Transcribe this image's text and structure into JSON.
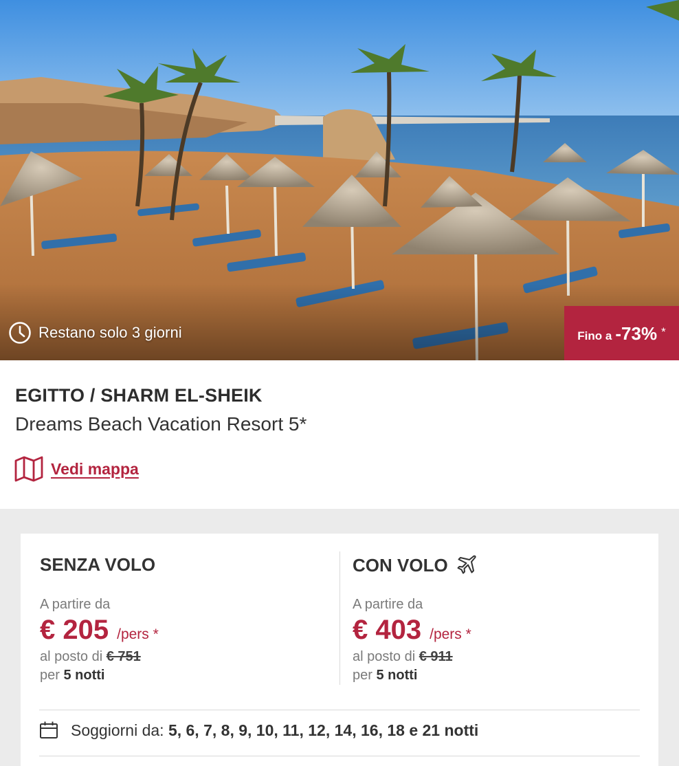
{
  "hero": {
    "countdown_text": "Restano solo 3 giorni",
    "discount_prefix": "Fino a",
    "discount_value": "-73%",
    "discount_asterisk": "*"
  },
  "listing": {
    "destination": "EGITTO / SHARM EL-SHEIK",
    "hotel_name": "Dreams Beach Vacation Resort 5*",
    "map_link_label": "Vedi mappa"
  },
  "offers": {
    "without_flight": {
      "title": "SENZA VOLO",
      "from_label": "A partire da",
      "price": "€ 205",
      "per_label": "/pers *",
      "instead_label": "al posto di",
      "old_price": "€ 751",
      "nights_prefix": "per",
      "nights": "5 notti"
    },
    "with_flight": {
      "title": "CON VOLO",
      "from_label": "A partire da",
      "price": "€ 403",
      "per_label": "/pers *",
      "instead_label": "al posto di",
      "old_price": "€ 911",
      "nights_prefix": "per",
      "nights": "5 notti"
    },
    "stays_label": "Soggiorni da:",
    "stays_values": "5, 6, 7, 8, 9, 10, 11, 12, 14, 16, 18 e 21 notti"
  },
  "icons": {
    "countdown": "clock-icon",
    "map": "map-icon",
    "flight": "airplane-icon",
    "stays": "calendar-icon"
  },
  "colors": {
    "accent": "#b3243f",
    "muted_text": "#7a7a7a",
    "band_background": "#ebebeb"
  }
}
